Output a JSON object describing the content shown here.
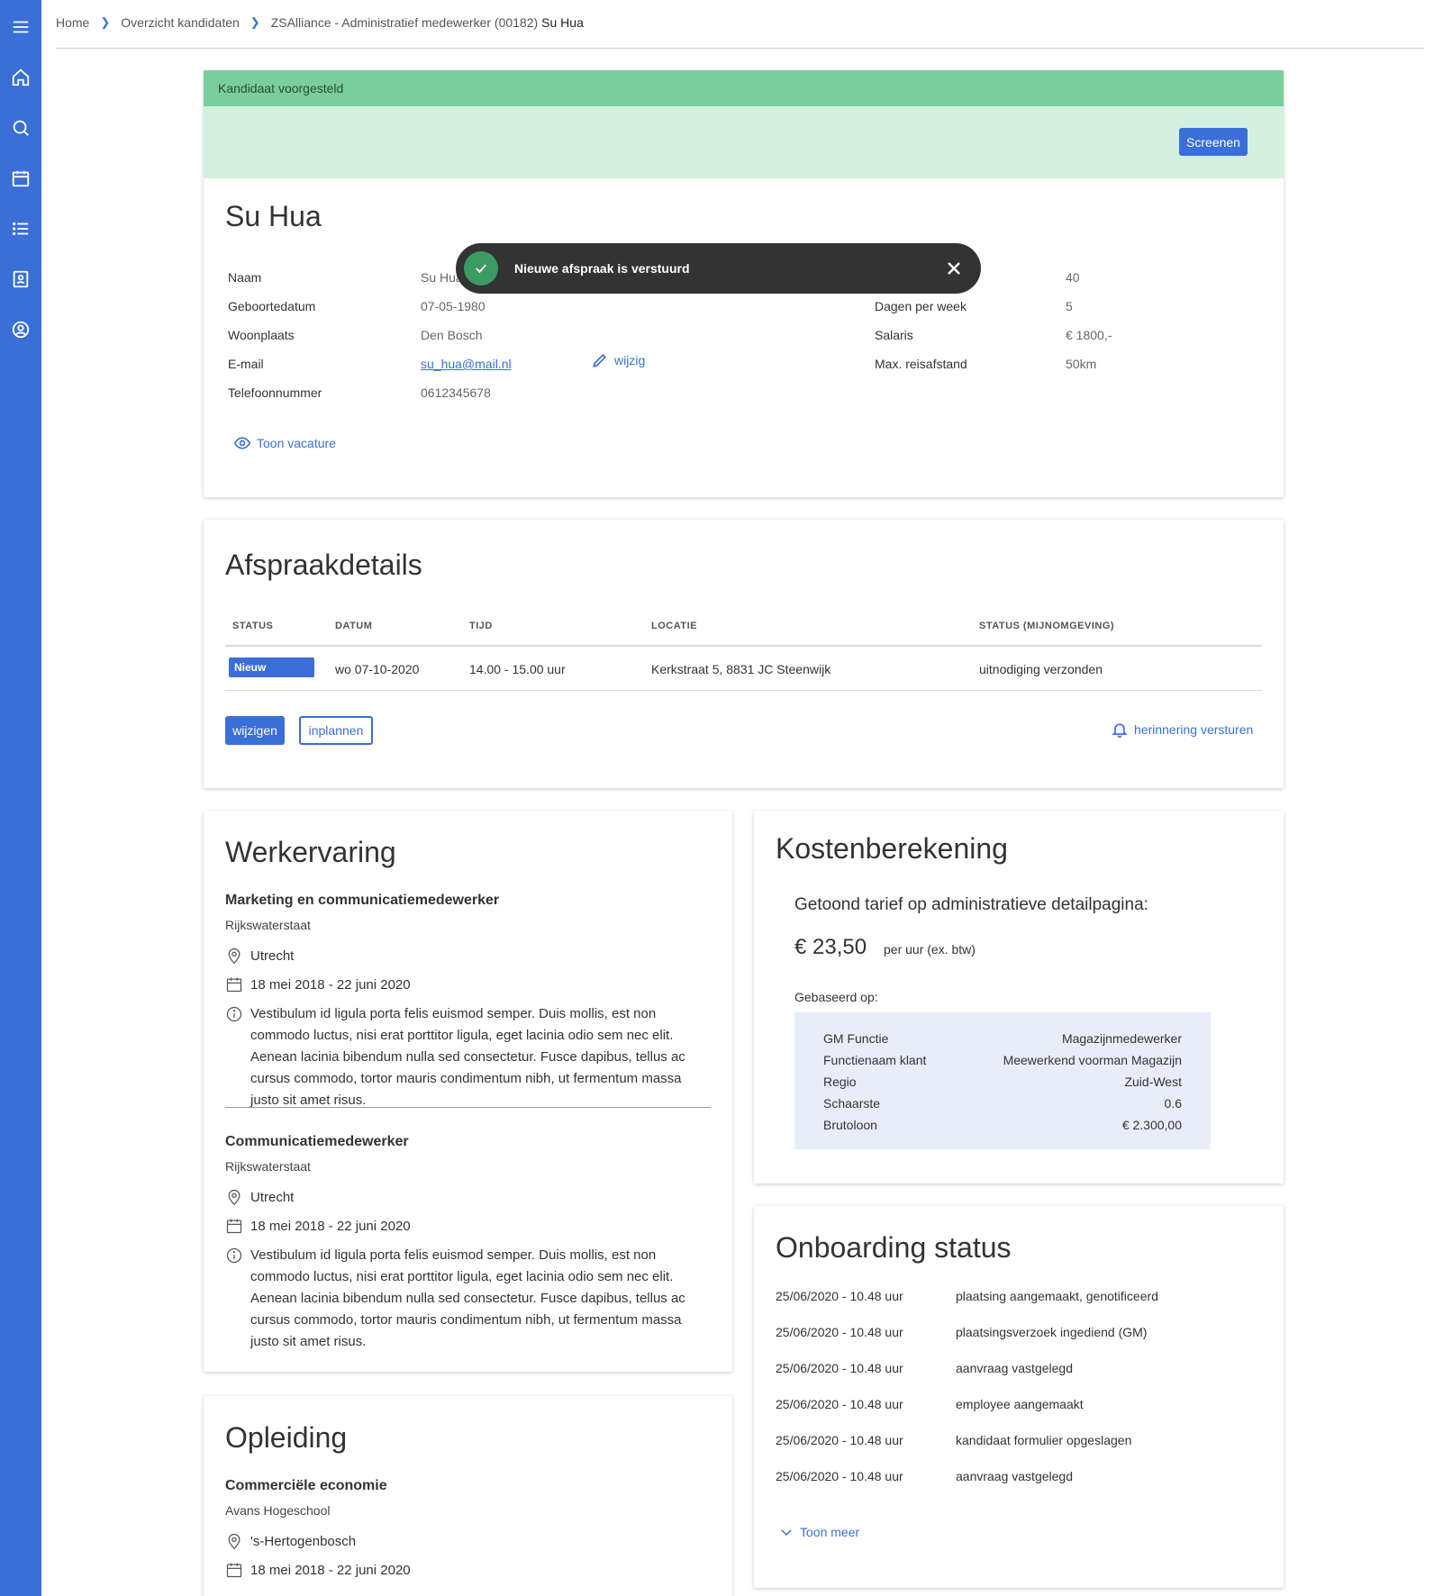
{
  "breadcrumb": {
    "home": "Home",
    "overview": "Overzicht kandidaten",
    "vacancy": "ZSAlliance - Administratief medewerker (00182)",
    "current": "Su Hua"
  },
  "candidate": {
    "status_header": "Kandidaat voorgesteld",
    "screen_button": "Screenen",
    "name": "Su Hua",
    "fields_left": [
      {
        "label": "Naam",
        "value": "Su Hua"
      },
      {
        "label": "Geboortedatum",
        "value": "07-05-1980"
      },
      {
        "label": "Woonplaats",
        "value": "Den Bosch"
      },
      {
        "label": "E-mail",
        "value": "su_hua@mail.nl"
      },
      {
        "label": "Telefoonnummer",
        "value": "0612345678"
      }
    ],
    "edit_link": "wijzig",
    "fields_right": [
      {
        "label": "",
        "value": "40"
      },
      {
        "label": "Dagen per week",
        "value": "5"
      },
      {
        "label": "Salaris",
        "value": "€ 1800,-"
      },
      {
        "label": "Max. reisafstand",
        "value": "50km"
      }
    ],
    "show_vacancy": "Toon vacature"
  },
  "toast": {
    "message": "Nieuwe afspraak is verstuurd"
  },
  "appointment": {
    "title": "Afspraakdetails",
    "columns": [
      "STATUS",
      "DATUM",
      "TIJD",
      "LOCATIE",
      "STATUS (MIJNOMGEVING)"
    ],
    "row": {
      "status": "Nieuw",
      "date": "wo 07-10-2020",
      "time": "14.00 - 15.00 uur",
      "location": "Kerkstraat 5, 8831 JC Steenwijk",
      "env_status": "uitnodiging verzonden"
    },
    "edit_button": "wijzigen",
    "schedule_button": "inplannen",
    "reminder_link": "herinnering versturen"
  },
  "experience": {
    "title": "Werkervaring",
    "items": [
      {
        "title": "Marketing en communicatiemedewerker",
        "org": "Rijkswaterstaat",
        "place": "Utrecht",
        "period": "18 mei 2018 - 22 juni 2020",
        "desc": "Vestibulum id ligula porta felis euismod semper. Duis mollis, est non commodo luctus, nisi erat porttitor ligula, eget lacinia odio sem nec elit. Aenean lacinia bibendum nulla sed consectetur. Fusce dapibus, tellus ac cursus commodo, tortor mauris condimentum nibh, ut fermentum massa justo sit amet risus."
      },
      {
        "title": "Communicatiemedewerker",
        "org": "Rijkswaterstaat",
        "place": "Utrecht",
        "period": "18 mei 2018 - 22 juni 2020",
        "desc": "Vestibulum id ligula porta felis euismod semper. Duis mollis, est non commodo luctus, nisi erat porttitor ligula, eget lacinia odio sem nec elit. Aenean lacinia bibendum nulla sed consectetur. Fusce dapibus, tellus ac cursus commodo, tortor mauris condimentum nibh, ut fermentum massa justo sit amet risus."
      }
    ]
  },
  "education": {
    "title": "Opleiding",
    "items": [
      {
        "title": "Commerciële economie",
        "org": "Avans Hogeschool",
        "place": "'s-Hertogenbosch",
        "period": "18 mei 2018 - 22 juni 2020"
      }
    ]
  },
  "costs": {
    "title": "Kostenberekening",
    "subtitle": "Getoond tarief op administratieve detailpagina:",
    "price": "€ 23,50",
    "unit": "per uur (ex. btw)",
    "based_on": "Gebaseerd op:",
    "rows": [
      {
        "label": "GM Functie",
        "value": "Magazijnmedewerker"
      },
      {
        "label": "Functienaam klant",
        "value": "Meewerkend voorman Magazijn"
      },
      {
        "label": "Regio",
        "value": "Zuid-West"
      },
      {
        "label": "Schaarste",
        "value": "0.6"
      },
      {
        "label": "Brutoloon",
        "value": "€ 2.300,00"
      }
    ]
  },
  "onboarding": {
    "title": "Onboarding status",
    "rows": [
      {
        "time": "25/06/2020 - 10.48 uur",
        "event": "plaatsing aangemaakt, genotificeerd"
      },
      {
        "time": "25/06/2020 - 10.48 uur",
        "event": "plaatsingsverzoek ingediend (GM)"
      },
      {
        "time": "25/06/2020 - 10.48 uur",
        "event": "aanvraag vastgelegd"
      },
      {
        "time": "25/06/2020 - 10.48 uur",
        "event": "employee aangemaakt"
      },
      {
        "time": "25/06/2020 - 10.48 uur",
        "event": "kandidaat formulier opgeslagen"
      },
      {
        "time": "25/06/2020 - 10.48 uur",
        "event": "aanvraag vastgelegd"
      }
    ],
    "show_more": "Toon meer"
  },
  "colors": {
    "accent": "#3a6fd8",
    "status_header": "#79cf9c",
    "status_band": "#d3efdf",
    "toast": "#333333",
    "toast_ok": "#3c9a62",
    "cost_box": "#e7eef9"
  }
}
